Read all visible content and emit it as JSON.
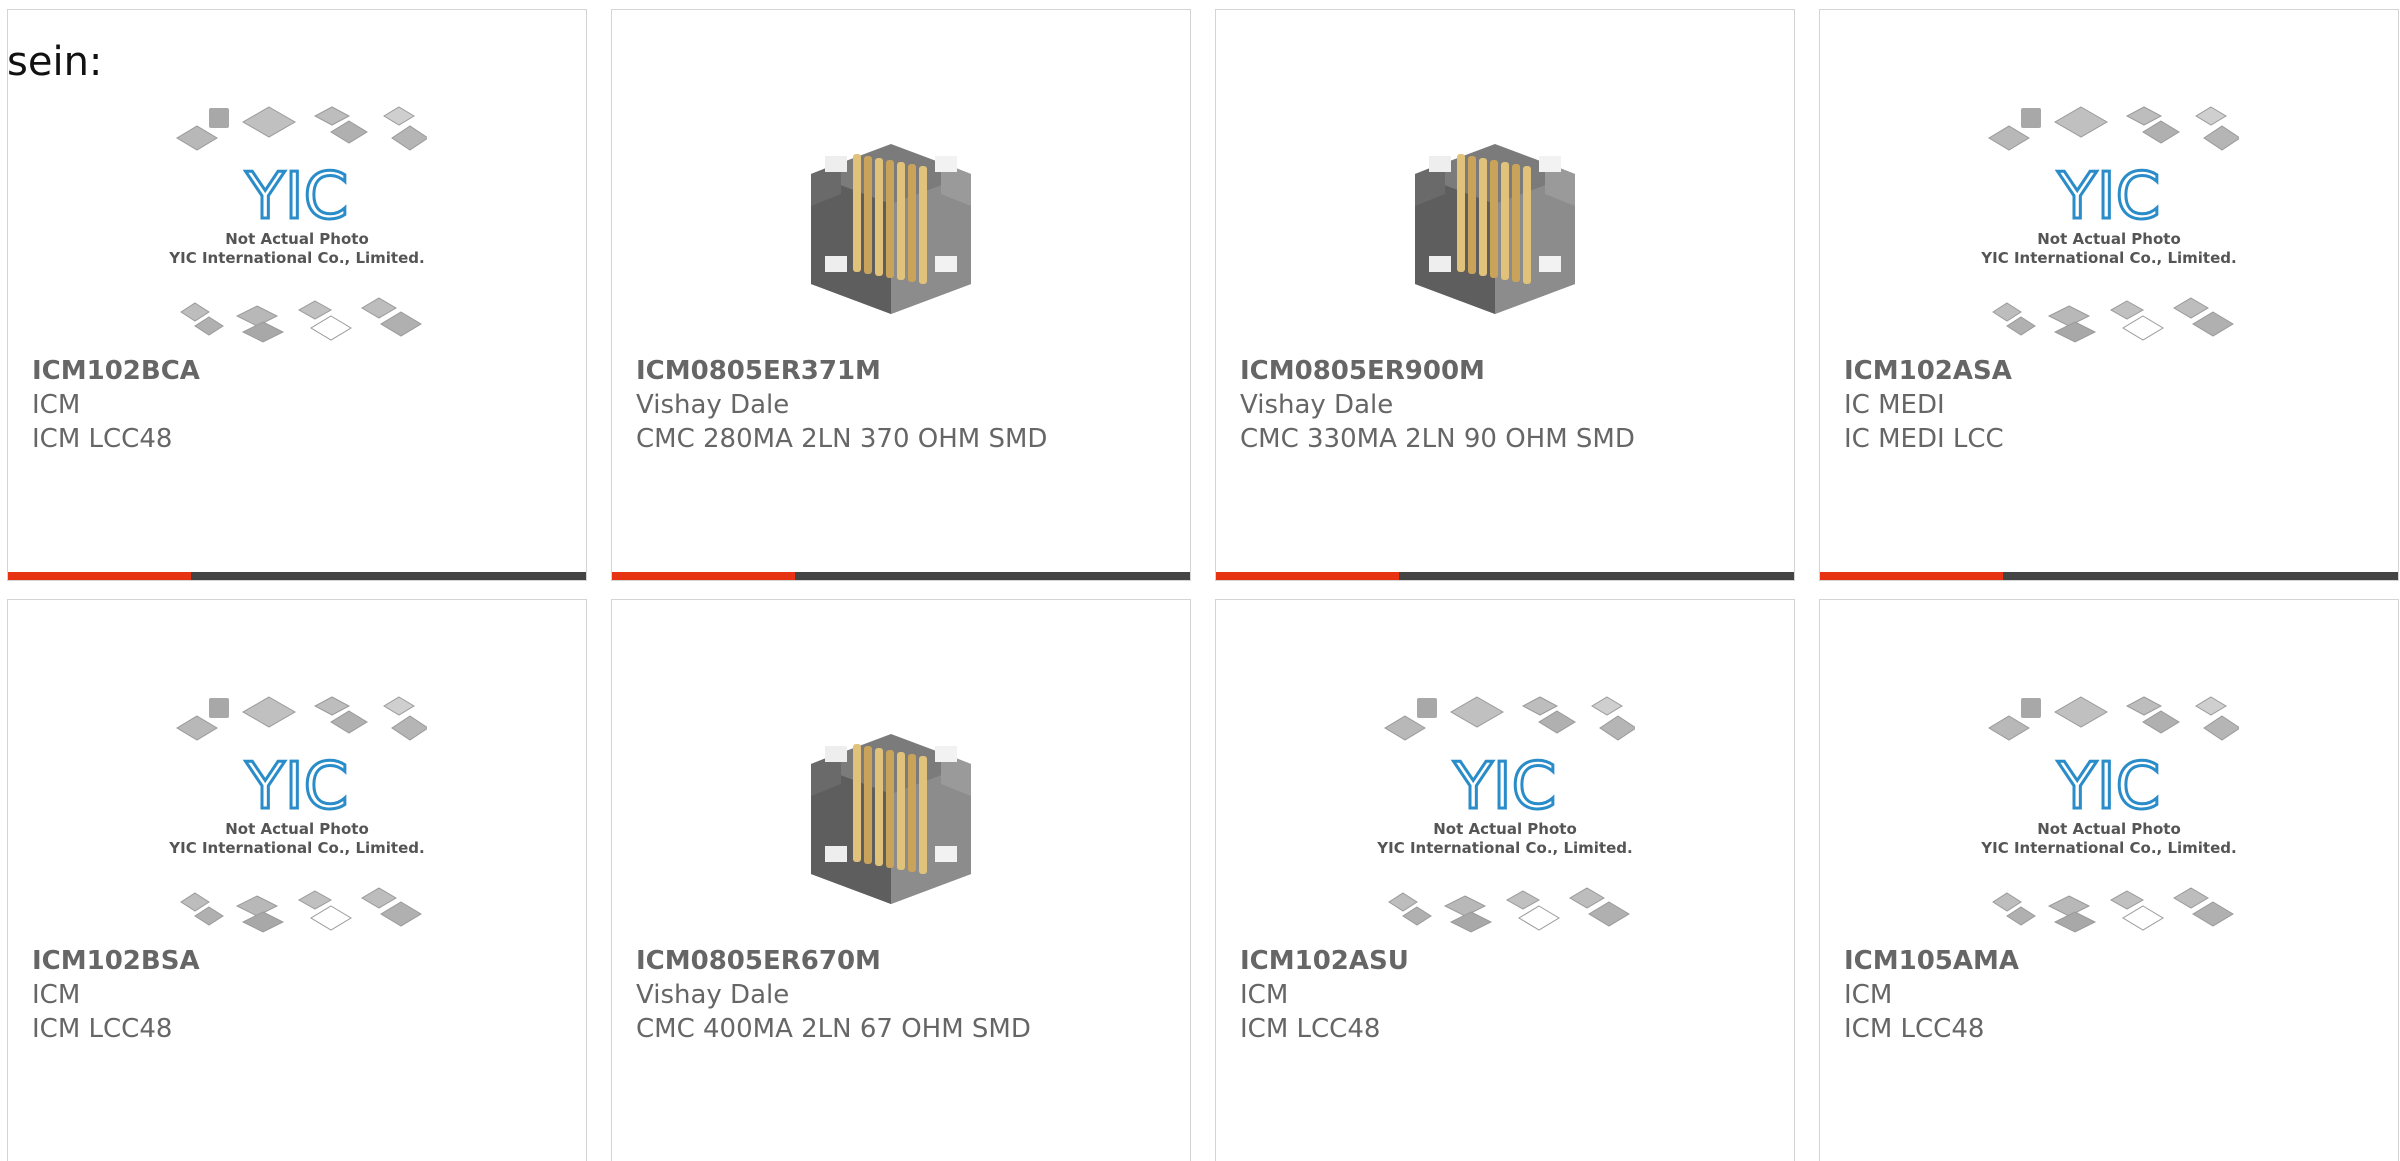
{
  "intro_text": "sein:",
  "placeholder_caption": [
    "Not Actual Photo",
    "YIC International Co., Limited."
  ],
  "logo_text": "YIC",
  "colors": {
    "accent": "#e63312",
    "bar_dark": "#444444",
    "text": "#666666",
    "logo_blue": "#2a8cc8"
  },
  "products": [
    {
      "part": "ICM102BCA",
      "maker": "ICM",
      "desc": "ICM LCC48",
      "image": "yic-placeholder-icon"
    },
    {
      "part": "ICM0805ER371M",
      "maker": "Vishay Dale",
      "desc": "CMC 280MA 2LN 370 OHM SMD",
      "image": "common-mode-choke-icon"
    },
    {
      "part": "ICM0805ER900M",
      "maker": "Vishay Dale",
      "desc": "CMC 330MA 2LN 90 OHM SMD",
      "image": "common-mode-choke-icon"
    },
    {
      "part": "ICM102ASA",
      "maker": "IC MEDI",
      "desc": "IC MEDI LCC",
      "image": "yic-placeholder-icon"
    },
    {
      "part": "ICM102BSA",
      "maker": "ICM",
      "desc": "ICM LCC48",
      "image": "yic-placeholder-icon"
    },
    {
      "part": "ICM0805ER670M",
      "maker": "Vishay Dale",
      "desc": "CMC 400MA 2LN 67 OHM SMD",
      "image": "common-mode-choke-icon"
    },
    {
      "part": "ICM102ASU",
      "maker": "ICM",
      "desc": "ICM LCC48",
      "image": "yic-placeholder-icon"
    },
    {
      "part": "ICM105AMA",
      "maker": "ICM",
      "desc": "ICM LCC48",
      "image": "yic-placeholder-icon"
    }
  ]
}
